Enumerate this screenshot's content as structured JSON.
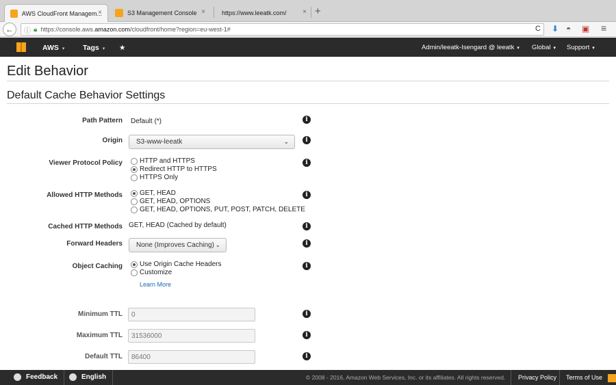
{
  "browser": {
    "tabs": [
      {
        "title": "AWS CloudFront Managem...",
        "close": "×"
      },
      {
        "title": "S3 Management Console",
        "close": "×"
      },
      {
        "title": "https://www.leeatk.com/",
        "close": "×"
      }
    ],
    "new_tab": "+",
    "url_prefix": "https://console.aws.",
    "url_domain": "amazon.com",
    "url_suffix": "/cloudfront/home?region=eu-west-1#",
    "reload": "C",
    "back": "←"
  },
  "awsnav": {
    "aws_label": "AWS",
    "tags_label": "Tags",
    "pin": "★",
    "account": "Admin/leeatk-Isengard @ leeatk",
    "region": "Global",
    "support": "Support",
    "caret": "▾"
  },
  "page": {
    "title": "Edit Behavior",
    "section": "Default Cache Behavior Settings"
  },
  "form": {
    "path_pattern": {
      "label": "Path Pattern",
      "value": "Default (*)"
    },
    "origin": {
      "label": "Origin",
      "value": "S3-www-leeatk"
    },
    "viewer_protocol": {
      "label": "Viewer Protocol Policy",
      "options": [
        "HTTP and HTTPS",
        "Redirect HTTP to HTTPS",
        "HTTPS Only"
      ],
      "selected": 1
    },
    "allowed_methods": {
      "label": "Allowed HTTP Methods",
      "options": [
        "GET, HEAD",
        "GET, HEAD, OPTIONS",
        "GET, HEAD, OPTIONS, PUT, POST, PATCH, DELETE"
      ],
      "selected": 0
    },
    "cached_methods": {
      "label": "Cached HTTP Methods",
      "value": "GET, HEAD (Cached by default)"
    },
    "forward_headers": {
      "label": "Forward Headers",
      "value": "None (Improves Caching)"
    },
    "object_caching": {
      "label": "Object Caching",
      "options": [
        "Use Origin Cache Headers",
        "Customize"
      ],
      "selected": 0,
      "learn_more": "Learn More"
    },
    "min_ttl": {
      "label": "Minimum TTL",
      "value": "0"
    },
    "max_ttl": {
      "label": "Maximum TTL",
      "value": "31536000"
    },
    "default_ttl": {
      "label": "Default TTL",
      "value": "86400"
    },
    "info_glyph": "i"
  },
  "footer": {
    "feedback": "Feedback",
    "language": "English",
    "copyright": "© 2008 - 2016, Amazon Web Services, Inc. or its affiliates. All rights reserved.",
    "privacy": "Privacy Policy",
    "terms": "Terms of Use"
  },
  "colors": {
    "nav_bg": "#2b2b2b",
    "aws_orange": "#f7a41d",
    "link_blue": "#1a66b3"
  }
}
